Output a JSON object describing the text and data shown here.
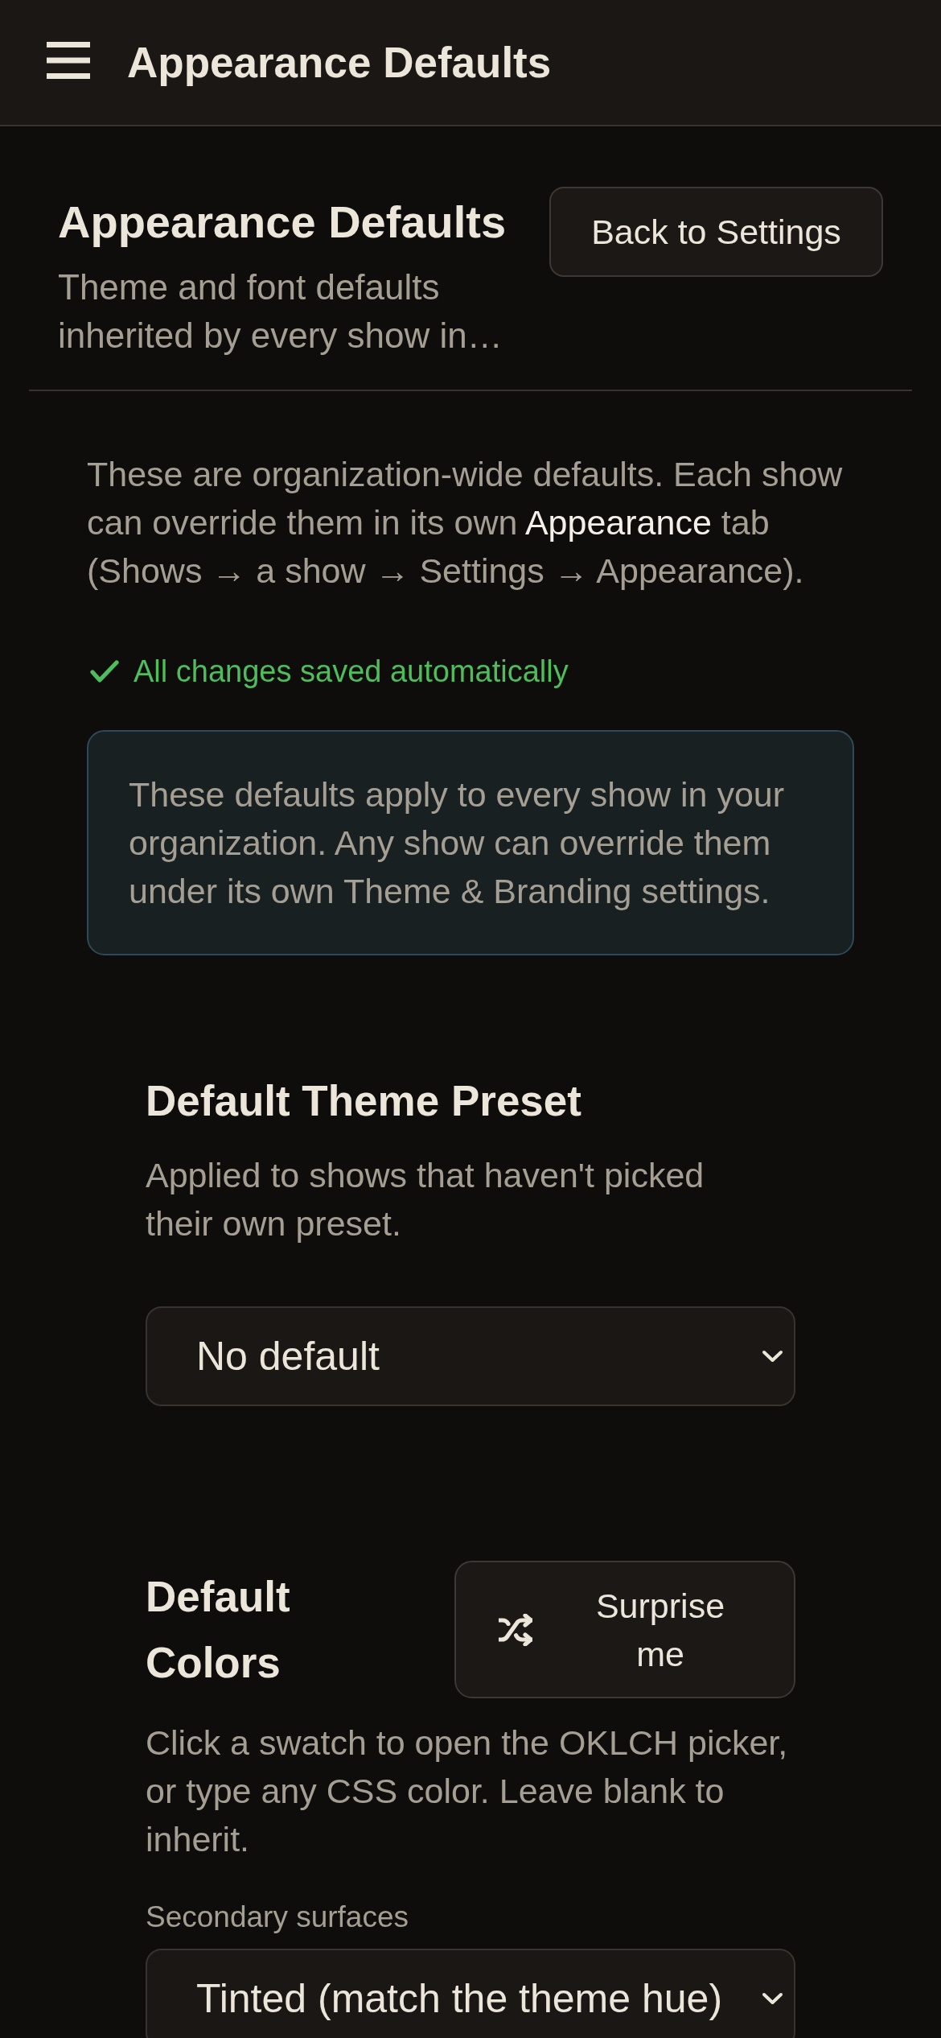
{
  "top_bar": {
    "title": "Appearance Defaults"
  },
  "header": {
    "title": "Appearance Defaults",
    "subtitle": "Theme and font defaults inherited by every show in…",
    "back_button": "Back to Settings"
  },
  "intro": "These are organization-wide defaults. Each show can override them in its own **Appearance** tab (Shows → a show → Settings → Appearance).",
  "save_status": {
    "text": "All changes saved automatically"
  },
  "notice": "These defaults apply to every show in your organization. Any show can override them under its own Theme & Branding settings.",
  "sections": [
    {
      "kind": "preset",
      "title": "Default Theme Preset",
      "description": "Applied to shows that haven't picked their own preset.",
      "dropdown": {
        "value": "No default"
      }
    },
    {
      "kind": "colors",
      "title": "Default Colors",
      "action_button": "Surprise me",
      "description": "Click a swatch to open the OKLCH picker, or type any CSS color. Leave blank to inherit.",
      "fields": [
        {
          "label": "Secondary surfaces",
          "value": "Tinted (match the theme hue)"
        }
      ]
    }
  ]
}
